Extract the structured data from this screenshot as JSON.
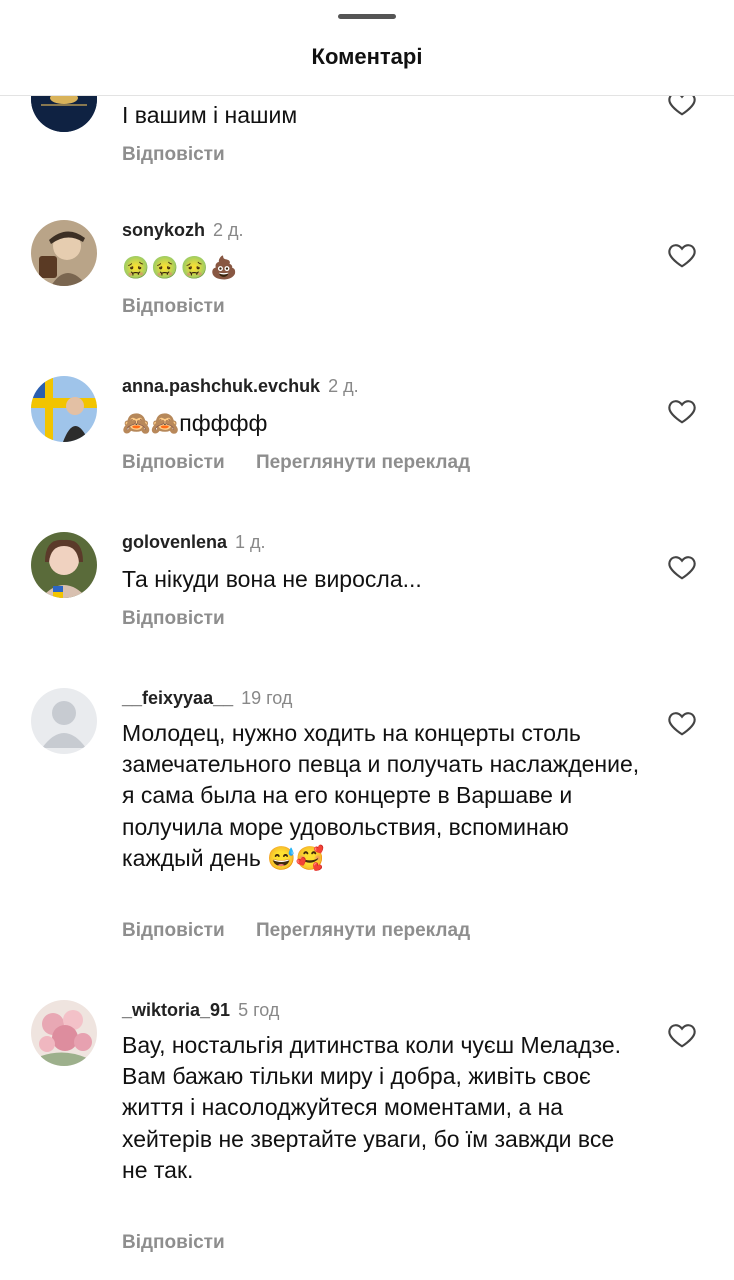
{
  "header": {
    "title": "Коментарі"
  },
  "comments": [
    {
      "username": "",
      "time": "",
      "text": "І вашим і нашим",
      "actions": [
        "Відповісти"
      ]
    },
    {
      "username": "sonykozh",
      "time": "2 д.",
      "text": "🤢🤢🤢💩",
      "actions": [
        "Відповісти"
      ]
    },
    {
      "username": "anna.pashchuk.evchuk",
      "time": "2 д.",
      "text": "🙈🙈пфффф",
      "actions": [
        "Відповісти",
        "Переглянути переклад"
      ]
    },
    {
      "username": "golovenlena",
      "time": "1 д.",
      "text": "Та нікуди вона не виросла...",
      "actions": [
        "Відповісти"
      ]
    },
    {
      "username": "__feixyyaa__",
      "time": "19 год",
      "text": "Молодец, нужно ходить на концерты столь замечательного певца и получать наслаждение, я сама была на его концерте в Варшаве и получила море удовольствия, вспоминаю каждый день 😅🥰",
      "actions": [
        "Відповісти",
        "Переглянути переклад"
      ]
    },
    {
      "username": "_wiktoria_91",
      "time": "5 год",
      "text": "Вау, ностальгія дитинства коли чуєш Меладзе. Вам бажаю тільки миру і добра, живіть своє життя і насолоджуйтеся моментами, а на хейтерів не звертайте уваги, бо їм завжди все не так.",
      "actions": [
        "Відповісти"
      ]
    }
  ]
}
